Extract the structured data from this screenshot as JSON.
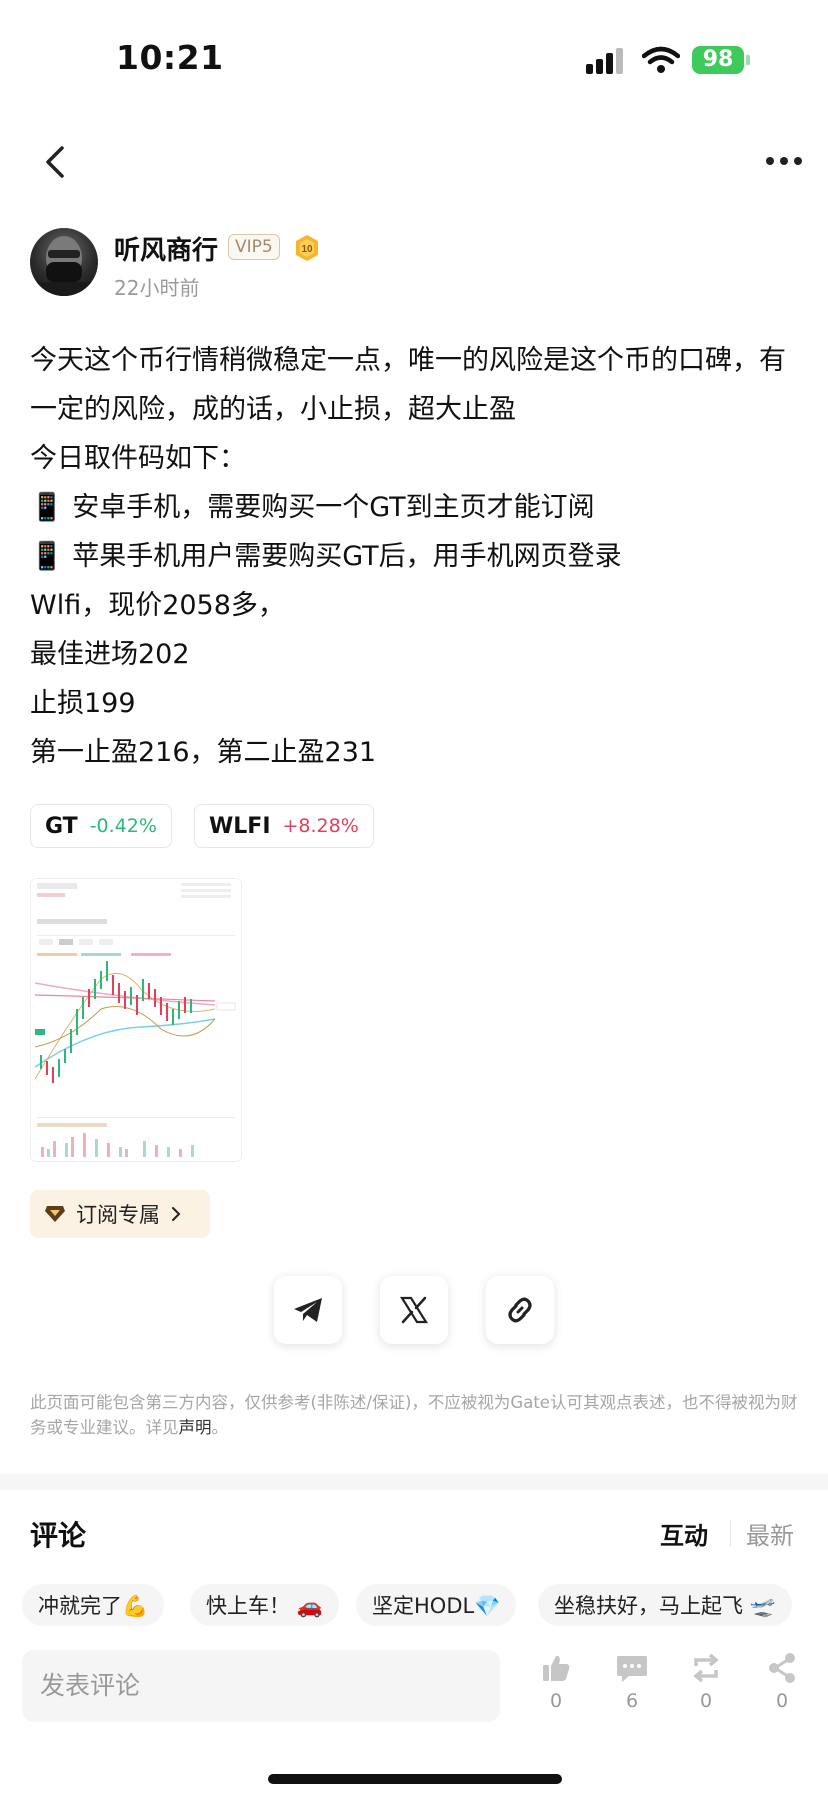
{
  "status_bar": {
    "time": "10:21",
    "battery": "98"
  },
  "nav": {
    "back_icon": "chevron-left-icon",
    "more_icon": "more-horizontal-icon"
  },
  "author": {
    "name": "听风商行",
    "vip_badge": "VIP5",
    "level": "10",
    "time_ago": "22小时前"
  },
  "post": {
    "lines": [
      "今天这个币行情稍微稳定一点，唯一的风险是这个币的口碑，有一定的风险，成的话，小止损，超大止盈",
      "今日取件码如下：",
      "📱 安卓手机，需要购买一个GT到主页才能订阅",
      "📱 苹果手机用户需要购买GT后，用手机网页登录",
      "Wlfi，现价2058多，",
      "最佳进场202",
      "止损199",
      "第一止盈216，第二止盈231"
    ]
  },
  "tickers": [
    {
      "symbol": "GT",
      "change": "-0.42%",
      "direction": "down"
    },
    {
      "symbol": "WLFI",
      "change": "+8.28%",
      "direction": "up"
    }
  ],
  "subscribe": {
    "label": "订阅专属",
    "icon": "diamond-icon"
  },
  "share": {
    "icons": [
      "telegram-icon",
      "x-logo-icon",
      "link-icon"
    ]
  },
  "disclaimer": {
    "text": "此页面可能包含第三方内容，仅供参考(非陈述/保证)，不应被视为Gate认可其观点表述，也不得被视为财务或专业建议。详见",
    "link": "声明",
    "end": "。"
  },
  "comments": {
    "title": "评论",
    "tabs": {
      "interact": "互动",
      "latest": "最新"
    },
    "quick_replies": [
      "冲就完了💪",
      "快上车！ 🚗",
      "坚定HODL💎",
      "坐稳扶好，马上起飞 🛫"
    ],
    "input_placeholder": "发表评论"
  },
  "actions": [
    {
      "name": "like",
      "icon": "thumbs-up-icon",
      "count": "0"
    },
    {
      "name": "comment",
      "icon": "comment-icon",
      "count": "6"
    },
    {
      "name": "repost",
      "icon": "repost-icon",
      "count": "0"
    },
    {
      "name": "share",
      "icon": "share-icon",
      "count": "0"
    }
  ],
  "colors": {
    "up": "#e0415a",
    "down": "#2db77a",
    "subscribe_bg": "#fbf2e3"
  }
}
